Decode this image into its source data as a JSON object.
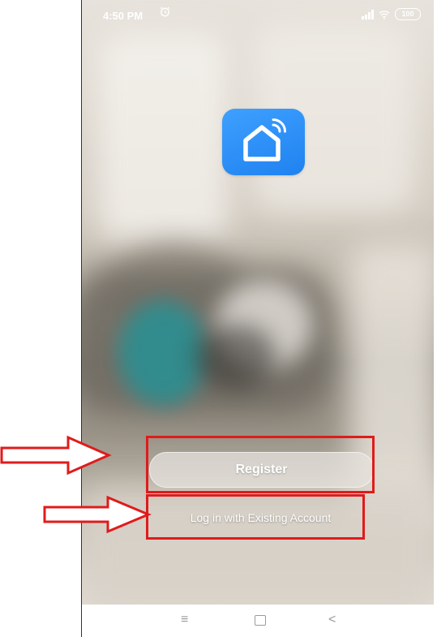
{
  "status_bar": {
    "time": "4:50 PM",
    "alarm_icon": "alarm-clock-icon",
    "signal_icon": "signal-bars-icon",
    "wifi_icon": "wifi-icon",
    "battery_level": "100"
  },
  "app": {
    "logo_icon": "smart-home-icon",
    "logo_color": "#2b8ff8"
  },
  "actions": {
    "register_label": "Register",
    "login_label": "Log in with Existing Account"
  },
  "annotations": {
    "highlight_color": "#e01b1b"
  },
  "nav_bar": {
    "menu_icon": "menu-icon",
    "home_icon": "home-square-icon",
    "back_icon": "back-chevron-icon",
    "menu_glyph": "≡",
    "back_glyph": "<"
  }
}
